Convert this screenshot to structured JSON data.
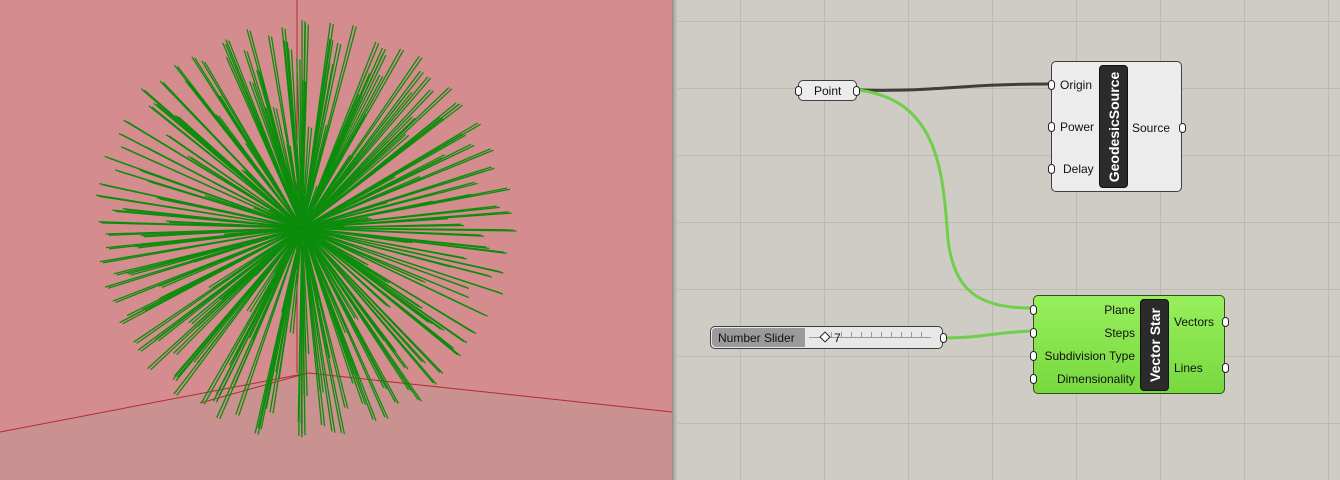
{
  "viewport": {
    "background_color": "#d48c8f",
    "floor_color": "#c9918f",
    "axis_color": "#b52a30",
    "ray_color": "#0c8c0c"
  },
  "canvas": {
    "background_color": "#cfcbc5",
    "grid_color": "#bcb8b2",
    "wire_dark": "#3e3e3e",
    "wire_green": "#6fcf4a"
  },
  "point_param": {
    "label": "Point"
  },
  "geodesic_source": {
    "title": "GeodesicSource",
    "inputs": [
      "Origin",
      "Power",
      "Delay"
    ],
    "outputs": [
      "Source"
    ]
  },
  "number_slider": {
    "label": "Number Slider",
    "value": "7"
  },
  "vector_star": {
    "title": "Vector Star",
    "inputs": [
      "Plane",
      "Steps",
      "Subdivision Type",
      "Dimensionality"
    ],
    "outputs": [
      "Vectors",
      "Lines"
    ],
    "color": "#86e64a"
  }
}
